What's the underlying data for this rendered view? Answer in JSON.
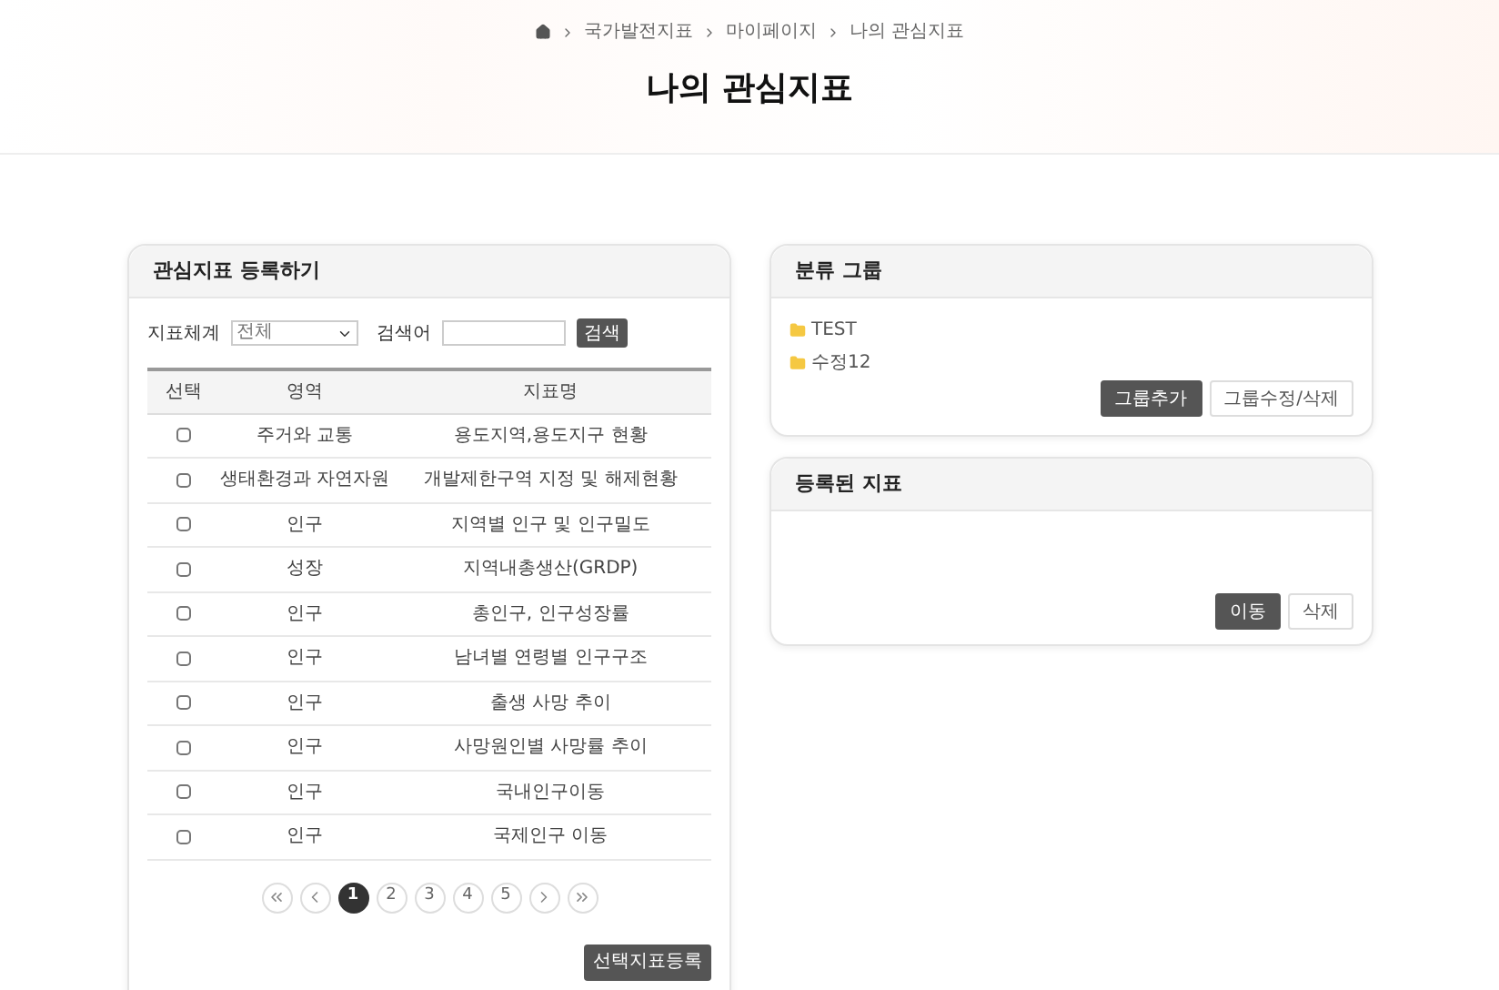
{
  "breadcrumb": [
    "국가발전지표",
    "마이페이지",
    "나의 관심지표"
  ],
  "page_title": "나의 관심지표",
  "register_panel": {
    "title": "관심지표 등록하기",
    "filter": {
      "system_label": "지표체계",
      "system_value": "전체",
      "keyword_label": "검색어",
      "search_button": "검색"
    },
    "table": {
      "columns": [
        "선택",
        "영역",
        "지표명"
      ],
      "rows": [
        {
          "checked": false,
          "area": "주거와 교통",
          "name": "용도지역,용도지구 현황"
        },
        {
          "checked": false,
          "area": "생태환경과 자연자원",
          "name": "개발제한구역 지정 및 해제현황"
        },
        {
          "checked": false,
          "area": "인구",
          "name": "지역별 인구 및 인구밀도"
        },
        {
          "checked": false,
          "area": "성장",
          "name": "지역내총생산(GRDP)"
        },
        {
          "checked": false,
          "area": "인구",
          "name": "총인구, 인구성장률"
        },
        {
          "checked": false,
          "area": "인구",
          "name": "남녀별 연령별 인구구조"
        },
        {
          "checked": false,
          "area": "인구",
          "name": "출생 사망 추이"
        },
        {
          "checked": false,
          "area": "인구",
          "name": "사망원인별 사망률 추이"
        },
        {
          "checked": false,
          "area": "인구",
          "name": "국내인구이동"
        },
        {
          "checked": false,
          "area": "인구",
          "name": "국제인구 이동"
        }
      ]
    },
    "pagination": [
      {
        "label": "1",
        "selected": true
      },
      {
        "label": "2",
        "selected": false
      },
      {
        "label": "3",
        "selected": false
      },
      {
        "label": "4",
        "selected": false
      },
      {
        "label": "5",
        "selected": false
      }
    ],
    "submit_button": "선택지표등록"
  },
  "group_panel": {
    "title": "분류 그룹",
    "groups": [
      "TEST",
      "수정12"
    ],
    "buttons": [
      {
        "label": "그룹추가",
        "kind": "primary"
      },
      {
        "label": "그룹수정/삭제",
        "kind": "secondary"
      }
    ]
  },
  "registered_panel": {
    "title": "등록된 지표",
    "buttons": [
      {
        "label": "이동",
        "kind": "primary"
      },
      {
        "label": "삭제",
        "kind": "secondary"
      }
    ]
  }
}
